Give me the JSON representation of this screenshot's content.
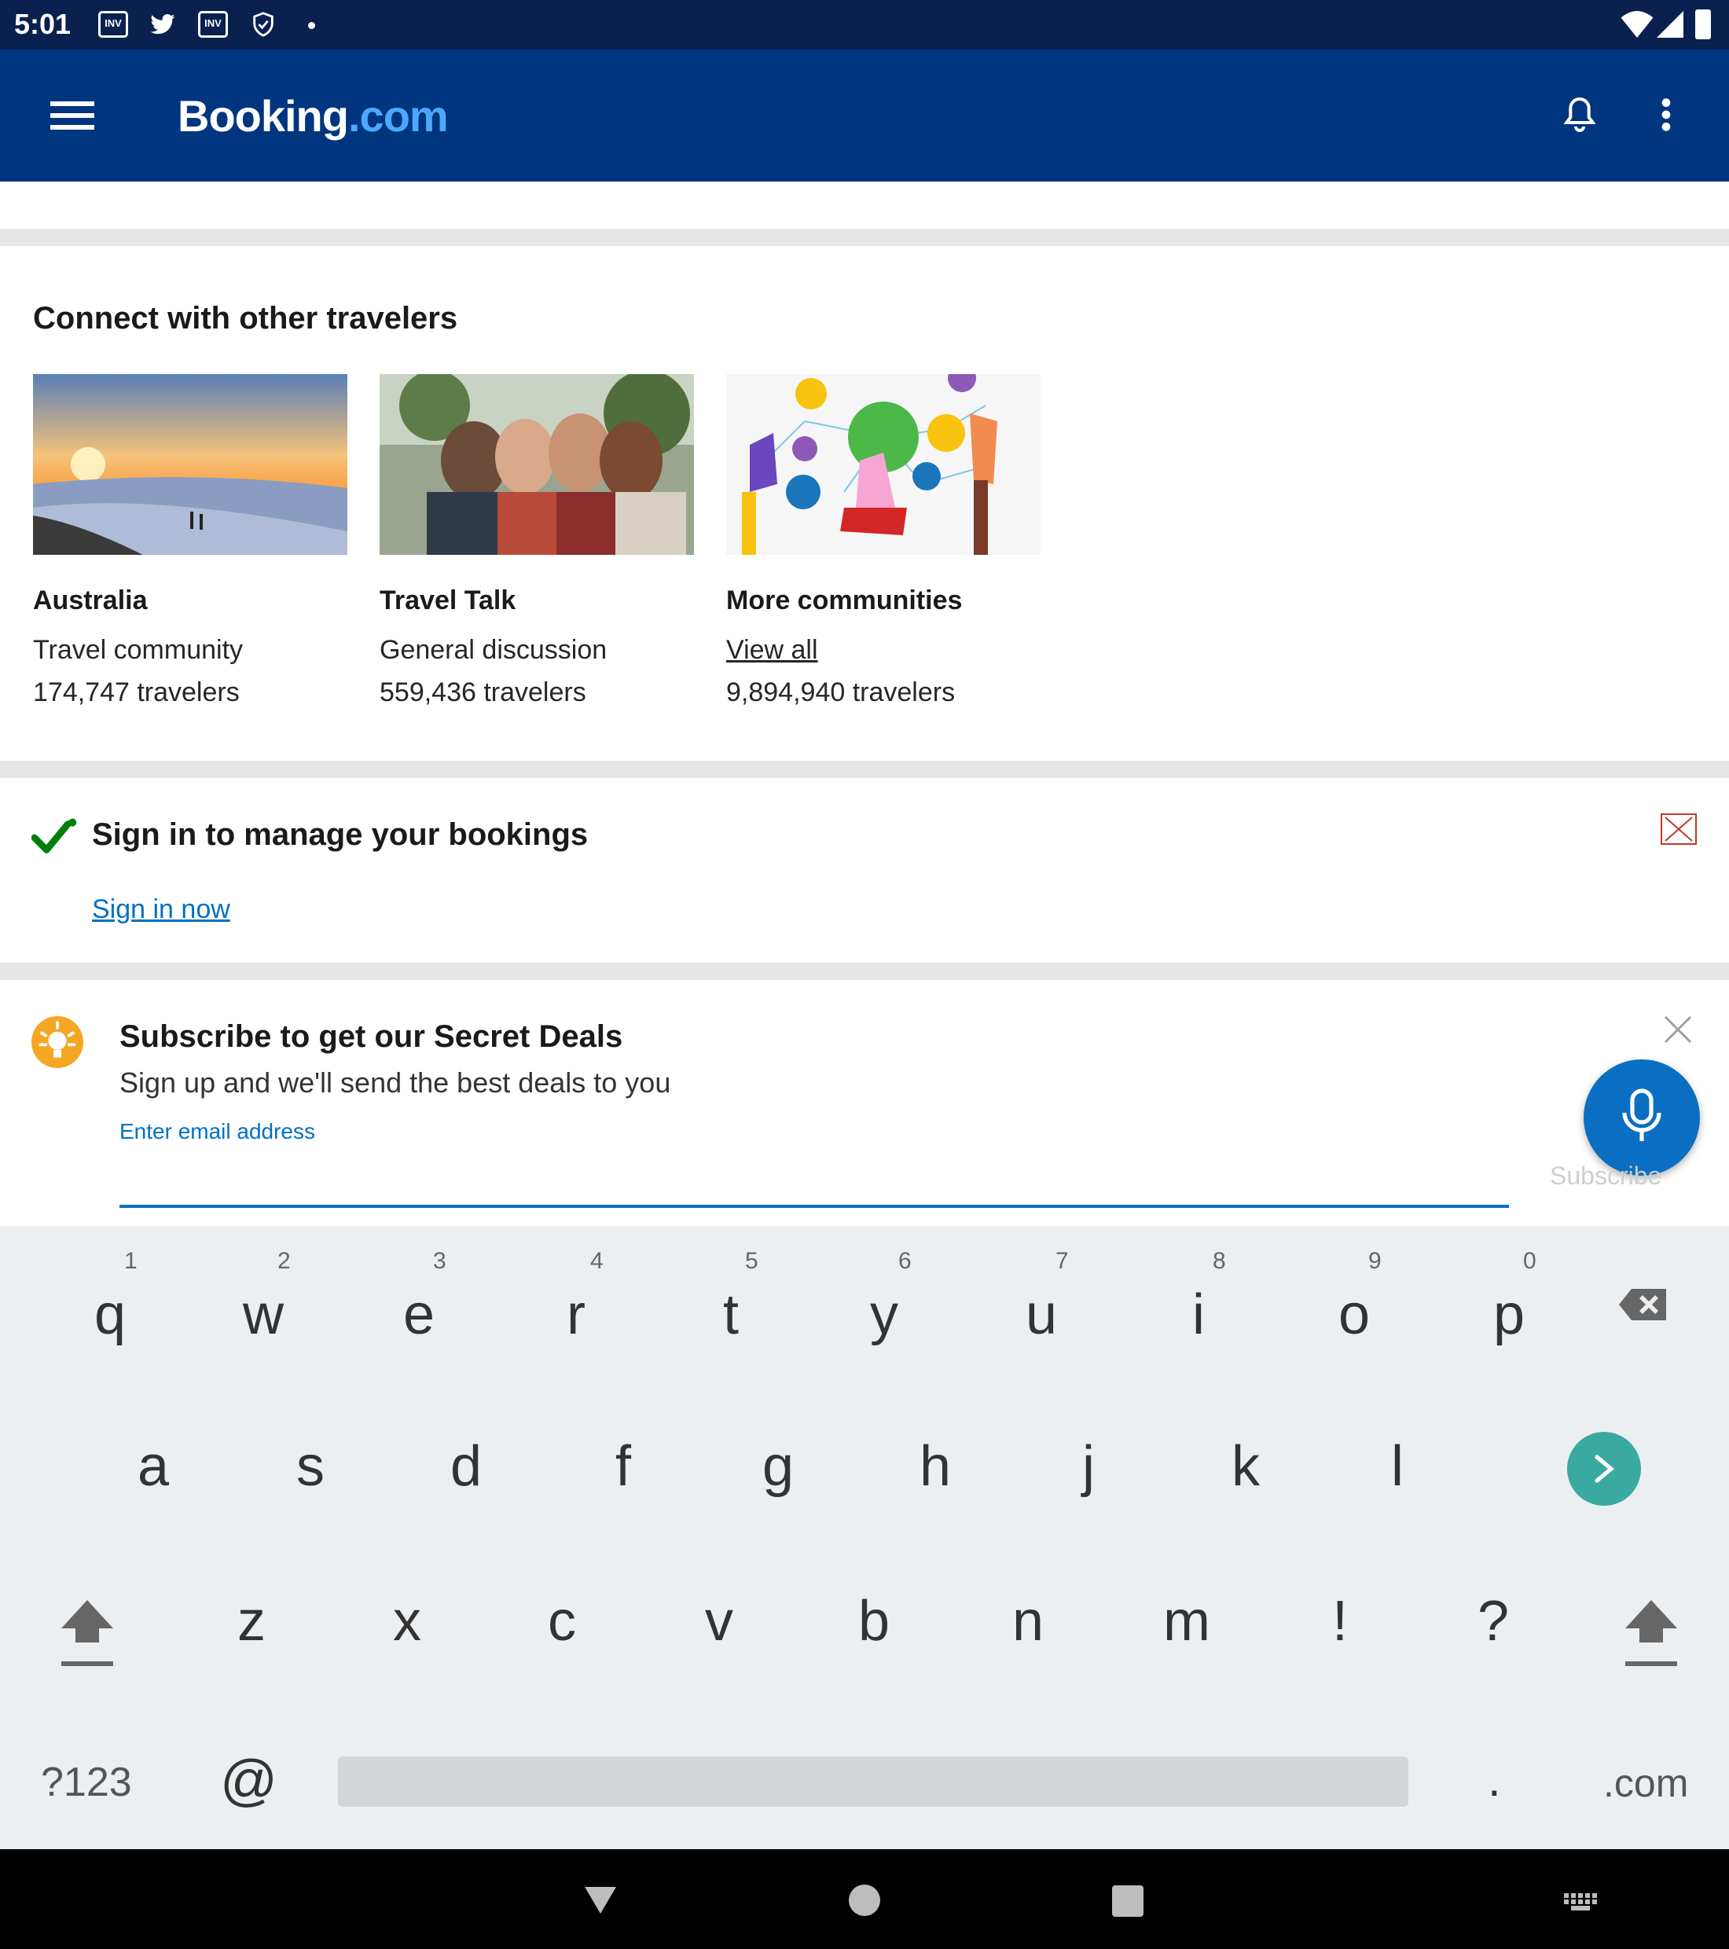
{
  "status_bar": {
    "time": "5:01"
  },
  "header": {
    "brand_main": "Booking",
    "brand_suffix": ".com"
  },
  "communities": {
    "title": "Connect with other travelers",
    "cards": [
      {
        "title": "Australia",
        "subtitle": "Travel community",
        "count": "174,747 travelers"
      },
      {
        "title": "Travel Talk",
        "subtitle": "General discussion",
        "count": "559,436 travelers"
      },
      {
        "title": "More communities",
        "subtitle": "View all",
        "count": "9,894,940 travelers"
      }
    ]
  },
  "signin_banner": {
    "title": "Sign in to manage your bookings",
    "link": "Sign in now"
  },
  "subscribe": {
    "title": "Subscribe to get our Secret Deals",
    "subtitle": "Sign up and we'll send the best deals to you",
    "input_label": "Enter email address",
    "button": "Subscribe"
  },
  "keyboard": {
    "row1": [
      "q",
      "w",
      "e",
      "r",
      "t",
      "y",
      "u",
      "i",
      "o",
      "p"
    ],
    "row1_hints": [
      "1",
      "2",
      "3",
      "4",
      "5",
      "6",
      "7",
      "8",
      "9",
      "0"
    ],
    "row2": [
      "a",
      "s",
      "d",
      "f",
      "g",
      "h",
      "j",
      "k",
      "l"
    ],
    "row3": [
      "z",
      "x",
      "c",
      "v",
      "b",
      "n",
      "m",
      "!",
      "?"
    ],
    "symbols_key": "?123",
    "at_key": "@",
    "period_key": ".",
    "dotcom_key": ".com"
  },
  "colors": {
    "brand_blue": "#003580",
    "link_blue": "#0071c2",
    "accent_orange": "#f5a623",
    "check_green": "#008009",
    "teal": "#3aa9a0"
  }
}
